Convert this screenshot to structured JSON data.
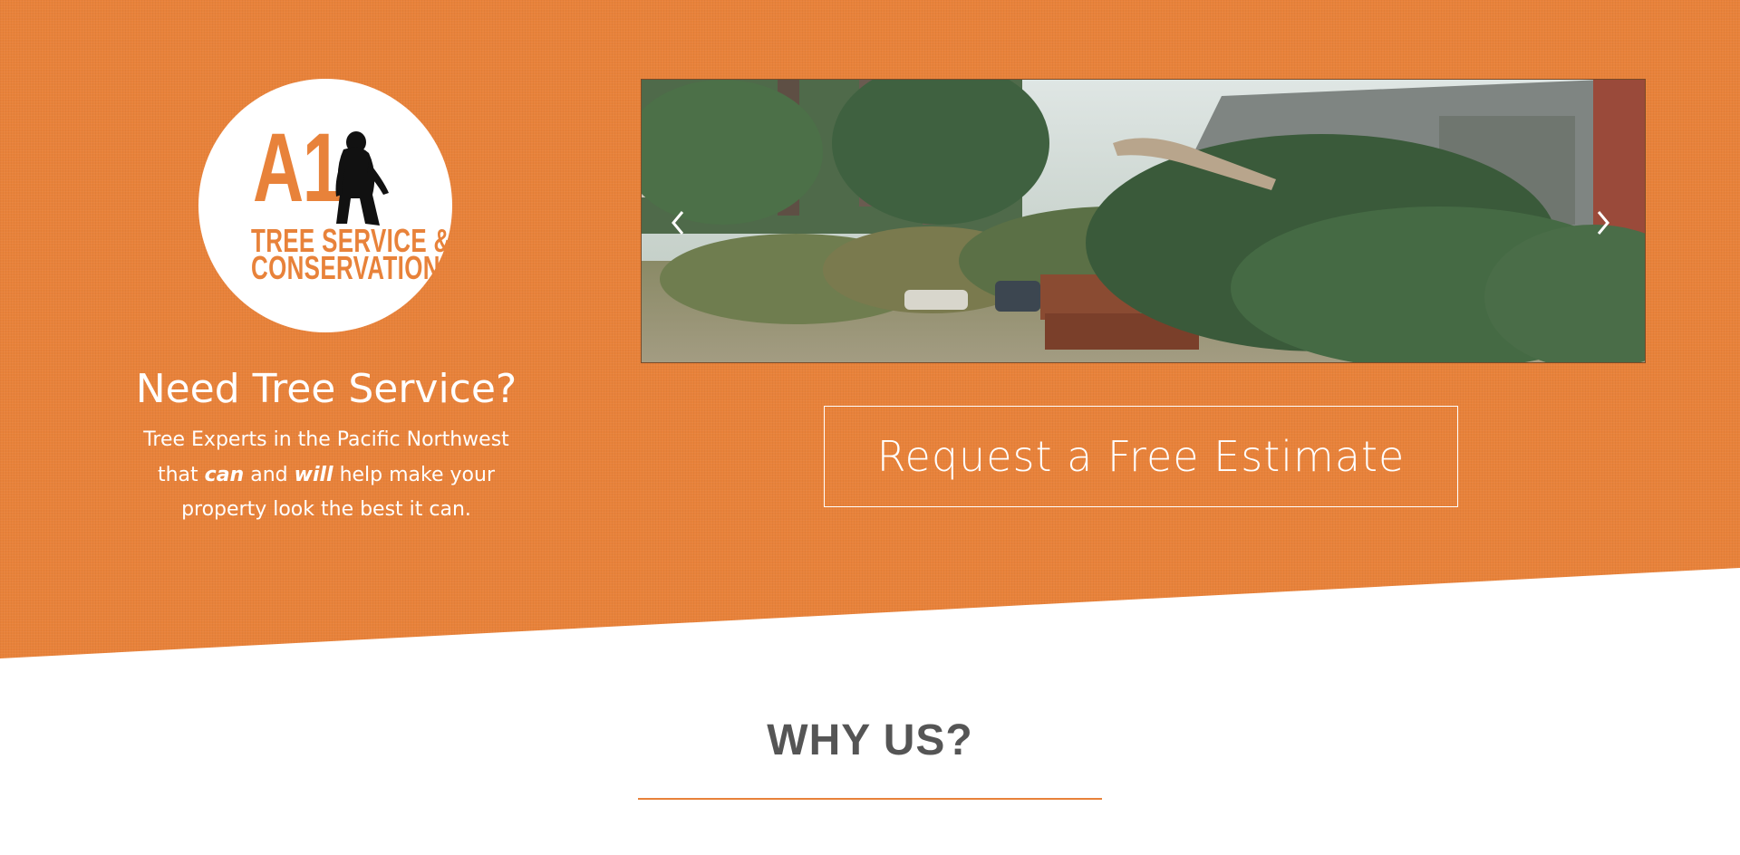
{
  "hero": {
    "logo": {
      "wordmark": "A1",
      "line1": "TREE SERVICE &",
      "line2": "CONSERVATION",
      "mascot": "bigfoot-silhouette-icon"
    },
    "title": "Need Tree Service?",
    "subtitle": {
      "line1": "Tree Experts in the Pacific Northwest",
      "part_that": "that",
      "em_can": "can",
      "part_and": "and",
      "em_will": "will",
      "part_rest": "help make your",
      "line3": "property look the best it can."
    },
    "slider": {
      "prev_icon": "chevron-left-icon",
      "next_icon": "chevron-right-icon"
    },
    "cta_label": "Request a Free Estimate"
  },
  "why": {
    "title": "WHY US?"
  },
  "colors": {
    "brand_orange": "#e8823a",
    "heading_gray": "#555555",
    "white": "#ffffff"
  }
}
